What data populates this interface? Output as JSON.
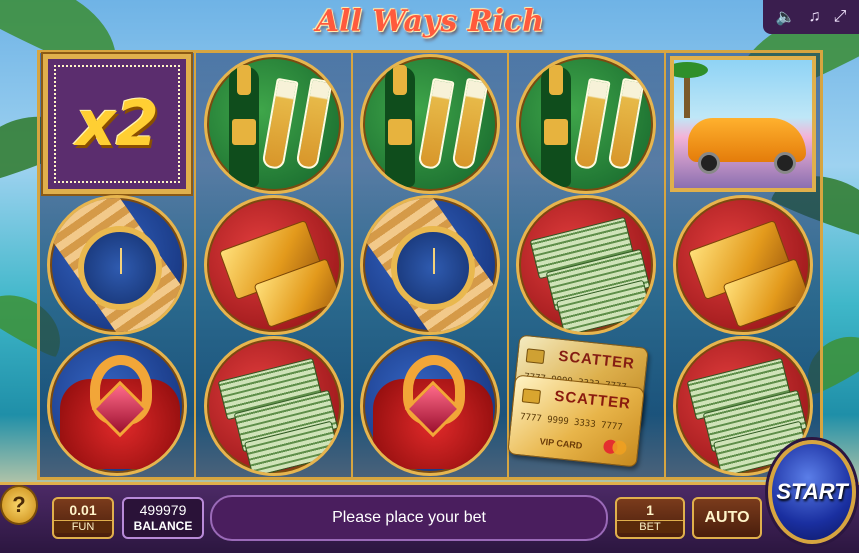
{
  "game": {
    "title": "All Ways Rich"
  },
  "top_controls": {
    "icons": [
      "speaker-icon",
      "music-icon",
      "fullscreen-icon"
    ],
    "glyphs": [
      "🔈",
      "♫",
      "⤢"
    ]
  },
  "reels": [
    {
      "symbols": [
        {
          "type": "multiplier",
          "label": "x2"
        },
        {
          "type": "watch"
        },
        {
          "type": "ring"
        }
      ]
    },
    {
      "symbols": [
        {
          "type": "champagne"
        },
        {
          "type": "gold-bars"
        },
        {
          "type": "cash"
        }
      ]
    },
    {
      "symbols": [
        {
          "type": "champagne"
        },
        {
          "type": "watch"
        },
        {
          "type": "ring"
        }
      ]
    },
    {
      "symbols": [
        {
          "type": "champagne"
        },
        {
          "type": "cash"
        },
        {
          "type": "scatter"
        }
      ]
    },
    {
      "symbols": [
        {
          "type": "sports-car"
        },
        {
          "type": "gold-bars"
        },
        {
          "type": "cash"
        }
      ]
    }
  ],
  "scatter": {
    "back_label": "SCATTER",
    "back_number": "7777 9999 3333 7777",
    "front_label": "SCATTER",
    "front_number": "7777 9999 3333 7777",
    "front_card_type": "VIP CARD"
  },
  "bottom_bar": {
    "help_label": "?",
    "coin_value": "0.01",
    "coin_label": "FUN",
    "balance_value": "499979",
    "balance_label": "BALANCE",
    "message": "Please place your bet",
    "bet_value": "1",
    "bet_label": "BET",
    "auto_label": "AUTO",
    "start_label": "START"
  },
  "colors": {
    "frame_gold": "#d7a540",
    "panel_purple": "#4c2a66",
    "start_blue": "#1a2fa0"
  }
}
